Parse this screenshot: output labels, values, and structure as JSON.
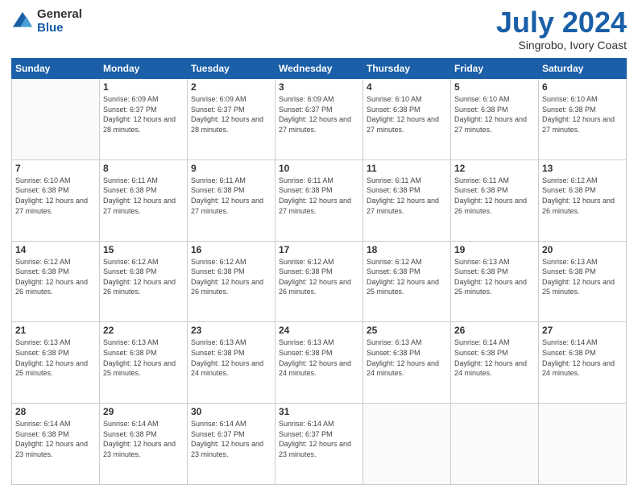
{
  "header": {
    "logo_general": "General",
    "logo_blue": "Blue",
    "title": "July 2024",
    "subtitle": "Singrobo, Ivory Coast"
  },
  "days_of_week": [
    "Sunday",
    "Monday",
    "Tuesday",
    "Wednesday",
    "Thursday",
    "Friday",
    "Saturday"
  ],
  "weeks": [
    [
      {
        "day": "",
        "sunrise": "",
        "sunset": "",
        "daylight": ""
      },
      {
        "day": "1",
        "sunrise": "6:09 AM",
        "sunset": "6:37 PM",
        "daylight": "12 hours and 28 minutes."
      },
      {
        "day": "2",
        "sunrise": "6:09 AM",
        "sunset": "6:37 PM",
        "daylight": "12 hours and 28 minutes."
      },
      {
        "day": "3",
        "sunrise": "6:09 AM",
        "sunset": "6:37 PM",
        "daylight": "12 hours and 27 minutes."
      },
      {
        "day": "4",
        "sunrise": "6:10 AM",
        "sunset": "6:38 PM",
        "daylight": "12 hours and 27 minutes."
      },
      {
        "day": "5",
        "sunrise": "6:10 AM",
        "sunset": "6:38 PM",
        "daylight": "12 hours and 27 minutes."
      },
      {
        "day": "6",
        "sunrise": "6:10 AM",
        "sunset": "6:38 PM",
        "daylight": "12 hours and 27 minutes."
      }
    ],
    [
      {
        "day": "7",
        "sunrise": "",
        "sunset": "",
        "daylight": ""
      },
      {
        "day": "8",
        "sunrise": "6:11 AM",
        "sunset": "6:38 PM",
        "daylight": "12 hours and 27 minutes."
      },
      {
        "day": "9",
        "sunrise": "6:11 AM",
        "sunset": "6:38 PM",
        "daylight": "12 hours and 27 minutes."
      },
      {
        "day": "10",
        "sunrise": "6:11 AM",
        "sunset": "6:38 PM",
        "daylight": "12 hours and 27 minutes."
      },
      {
        "day": "11",
        "sunrise": "6:11 AM",
        "sunset": "6:38 PM",
        "daylight": "12 hours and 27 minutes."
      },
      {
        "day": "12",
        "sunrise": "6:11 AM",
        "sunset": "6:38 PM",
        "daylight": "12 hours and 26 minutes."
      },
      {
        "day": "13",
        "sunrise": "6:12 AM",
        "sunset": "6:38 PM",
        "daylight": "12 hours and 26 minutes."
      }
    ],
    [
      {
        "day": "14",
        "sunrise": "",
        "sunset": "",
        "daylight": ""
      },
      {
        "day": "15",
        "sunrise": "6:12 AM",
        "sunset": "6:38 PM",
        "daylight": "12 hours and 26 minutes."
      },
      {
        "day": "16",
        "sunrise": "6:12 AM",
        "sunset": "6:38 PM",
        "daylight": "12 hours and 26 minutes."
      },
      {
        "day": "17",
        "sunrise": "6:12 AM",
        "sunset": "6:38 PM",
        "daylight": "12 hours and 26 minutes."
      },
      {
        "day": "18",
        "sunrise": "6:12 AM",
        "sunset": "6:38 PM",
        "daylight": "12 hours and 25 minutes."
      },
      {
        "day": "19",
        "sunrise": "6:13 AM",
        "sunset": "6:38 PM",
        "daylight": "12 hours and 25 minutes."
      },
      {
        "day": "20",
        "sunrise": "6:13 AM",
        "sunset": "6:38 PM",
        "daylight": "12 hours and 25 minutes."
      }
    ],
    [
      {
        "day": "21",
        "sunrise": "",
        "sunset": "",
        "daylight": ""
      },
      {
        "day": "22",
        "sunrise": "6:13 AM",
        "sunset": "6:38 PM",
        "daylight": "12 hours and 25 minutes."
      },
      {
        "day": "23",
        "sunrise": "6:13 AM",
        "sunset": "6:38 PM",
        "daylight": "12 hours and 24 minutes."
      },
      {
        "day": "24",
        "sunrise": "6:13 AM",
        "sunset": "6:38 PM",
        "daylight": "12 hours and 24 minutes."
      },
      {
        "day": "25",
        "sunrise": "6:13 AM",
        "sunset": "6:38 PM",
        "daylight": "12 hours and 24 minutes."
      },
      {
        "day": "26",
        "sunrise": "6:14 AM",
        "sunset": "6:38 PM",
        "daylight": "12 hours and 24 minutes."
      },
      {
        "day": "27",
        "sunrise": "6:14 AM",
        "sunset": "6:38 PM",
        "daylight": "12 hours and 24 minutes."
      }
    ],
    [
      {
        "day": "28",
        "sunrise": "6:14 AM",
        "sunset": "6:38 PM",
        "daylight": "12 hours and 23 minutes."
      },
      {
        "day": "29",
        "sunrise": "6:14 AM",
        "sunset": "6:38 PM",
        "daylight": "12 hours and 23 minutes."
      },
      {
        "day": "30",
        "sunrise": "6:14 AM",
        "sunset": "6:37 PM",
        "daylight": "12 hours and 23 minutes."
      },
      {
        "day": "31",
        "sunrise": "6:14 AM",
        "sunset": "6:37 PM",
        "daylight": "12 hours and 23 minutes."
      },
      {
        "day": "",
        "sunrise": "",
        "sunset": "",
        "daylight": ""
      },
      {
        "day": "",
        "sunrise": "",
        "sunset": "",
        "daylight": ""
      },
      {
        "day": "",
        "sunrise": "",
        "sunset": "",
        "daylight": ""
      }
    ]
  ],
  "week1_day7_sunrise": "6:10 AM",
  "week1_day7_sunset": "6:38 PM",
  "week1_day7_daylight": "12 hours and 27 minutes.",
  "week2_day7_sunrise": "",
  "week3_day14_sunrise": "6:12 AM",
  "week3_day14_sunset": "6:38 PM",
  "week3_day14_daylight": "12 hours and 26 minutes.",
  "week4_day21_sunrise": "6:13 AM",
  "week4_day21_sunset": "6:38 PM",
  "week4_day21_daylight": "12 hours and 25 minutes."
}
